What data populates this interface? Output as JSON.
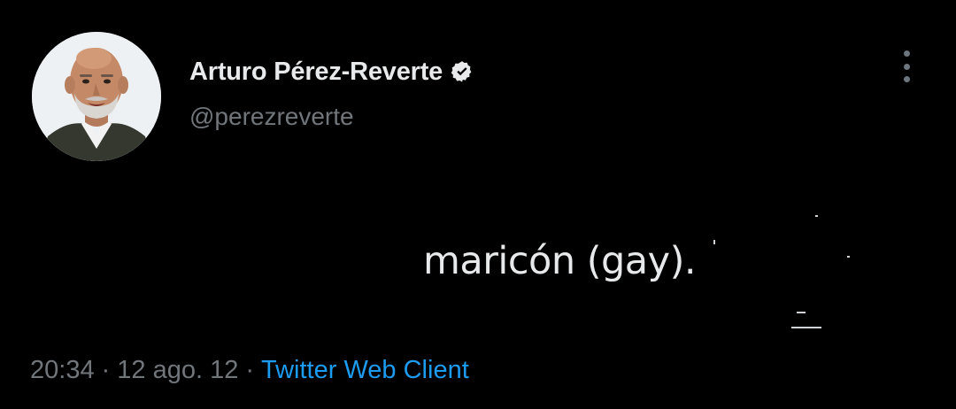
{
  "tweet": {
    "author": {
      "display_name": "Arturo Pérez-Reverte",
      "handle": "@perezreverte",
      "verified": true,
      "avatar_icon": "profile-photo"
    },
    "text": "maricón (gay).",
    "meta": {
      "time": "20:34",
      "separator": "·",
      "date": "12 ago. 12",
      "client": "Twitter Web Client"
    },
    "more_icon": "more-vertical-icon"
  },
  "colors": {
    "background": "#000000",
    "primary_text": "#e7e9ea",
    "secondary_text": "#71767b",
    "link": "#1d9bf0",
    "verified_badge": "#e7e9ea"
  }
}
